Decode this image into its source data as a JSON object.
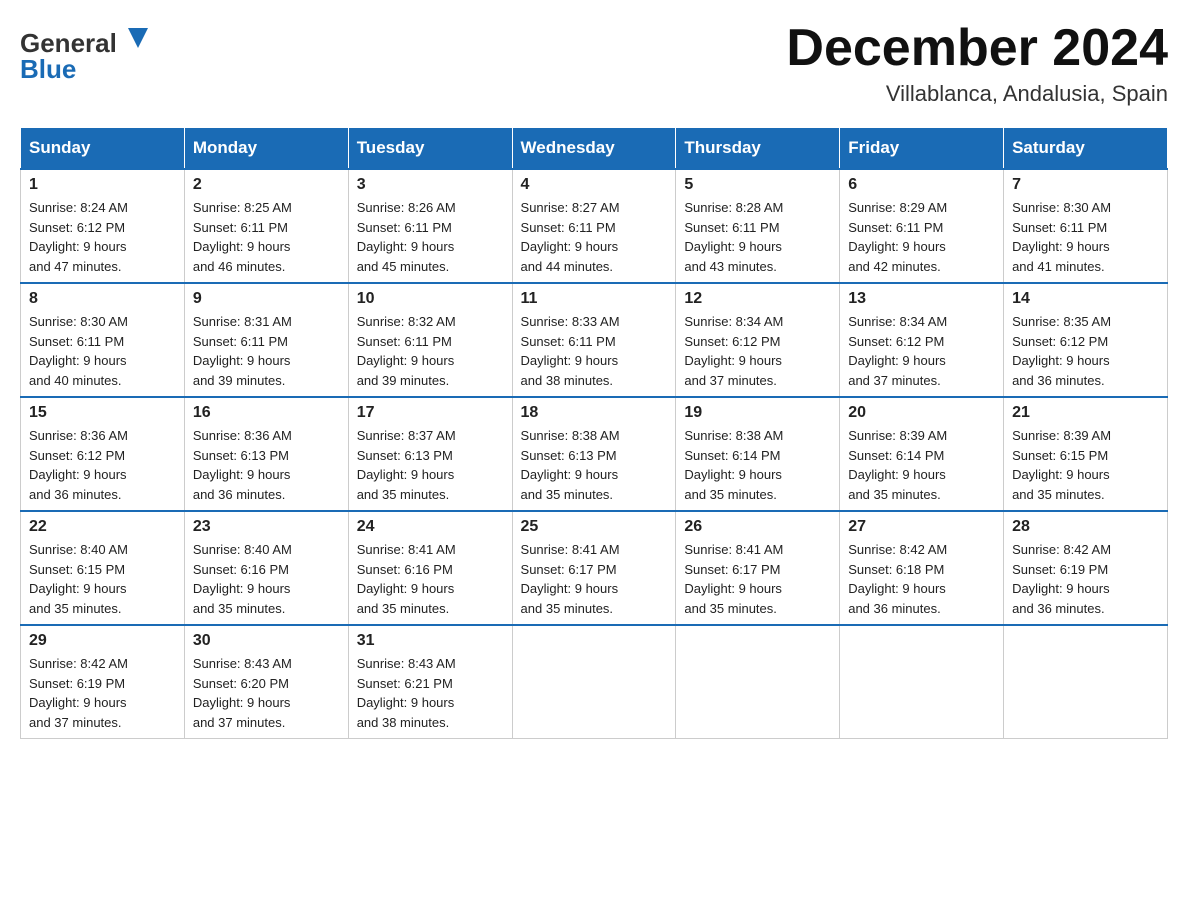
{
  "logo": {
    "general": "General",
    "blue": "Blue"
  },
  "title": "December 2024",
  "location": "Villablanca, Andalusia, Spain",
  "days_of_week": [
    "Sunday",
    "Monday",
    "Tuesday",
    "Wednesday",
    "Thursday",
    "Friday",
    "Saturday"
  ],
  "weeks": [
    [
      {
        "day": "1",
        "sunrise": "8:24 AM",
        "sunset": "6:12 PM",
        "daylight": "9 hours and 47 minutes."
      },
      {
        "day": "2",
        "sunrise": "8:25 AM",
        "sunset": "6:11 PM",
        "daylight": "9 hours and 46 minutes."
      },
      {
        "day": "3",
        "sunrise": "8:26 AM",
        "sunset": "6:11 PM",
        "daylight": "9 hours and 45 minutes."
      },
      {
        "day": "4",
        "sunrise": "8:27 AM",
        "sunset": "6:11 PM",
        "daylight": "9 hours and 44 minutes."
      },
      {
        "day": "5",
        "sunrise": "8:28 AM",
        "sunset": "6:11 PM",
        "daylight": "9 hours and 43 minutes."
      },
      {
        "day": "6",
        "sunrise": "8:29 AM",
        "sunset": "6:11 PM",
        "daylight": "9 hours and 42 minutes."
      },
      {
        "day": "7",
        "sunrise": "8:30 AM",
        "sunset": "6:11 PM",
        "daylight": "9 hours and 41 minutes."
      }
    ],
    [
      {
        "day": "8",
        "sunrise": "8:30 AM",
        "sunset": "6:11 PM",
        "daylight": "9 hours and 40 minutes."
      },
      {
        "day": "9",
        "sunrise": "8:31 AM",
        "sunset": "6:11 PM",
        "daylight": "9 hours and 39 minutes."
      },
      {
        "day": "10",
        "sunrise": "8:32 AM",
        "sunset": "6:11 PM",
        "daylight": "9 hours and 39 minutes."
      },
      {
        "day": "11",
        "sunrise": "8:33 AM",
        "sunset": "6:11 PM",
        "daylight": "9 hours and 38 minutes."
      },
      {
        "day": "12",
        "sunrise": "8:34 AM",
        "sunset": "6:12 PM",
        "daylight": "9 hours and 37 minutes."
      },
      {
        "day": "13",
        "sunrise": "8:34 AM",
        "sunset": "6:12 PM",
        "daylight": "9 hours and 37 minutes."
      },
      {
        "day": "14",
        "sunrise": "8:35 AM",
        "sunset": "6:12 PM",
        "daylight": "9 hours and 36 minutes."
      }
    ],
    [
      {
        "day": "15",
        "sunrise": "8:36 AM",
        "sunset": "6:12 PM",
        "daylight": "9 hours and 36 minutes."
      },
      {
        "day": "16",
        "sunrise": "8:36 AM",
        "sunset": "6:13 PM",
        "daylight": "9 hours and 36 minutes."
      },
      {
        "day": "17",
        "sunrise": "8:37 AM",
        "sunset": "6:13 PM",
        "daylight": "9 hours and 35 minutes."
      },
      {
        "day": "18",
        "sunrise": "8:38 AM",
        "sunset": "6:13 PM",
        "daylight": "9 hours and 35 minutes."
      },
      {
        "day": "19",
        "sunrise": "8:38 AM",
        "sunset": "6:14 PM",
        "daylight": "9 hours and 35 minutes."
      },
      {
        "day": "20",
        "sunrise": "8:39 AM",
        "sunset": "6:14 PM",
        "daylight": "9 hours and 35 minutes."
      },
      {
        "day": "21",
        "sunrise": "8:39 AM",
        "sunset": "6:15 PM",
        "daylight": "9 hours and 35 minutes."
      }
    ],
    [
      {
        "day": "22",
        "sunrise": "8:40 AM",
        "sunset": "6:15 PM",
        "daylight": "9 hours and 35 minutes."
      },
      {
        "day": "23",
        "sunrise": "8:40 AM",
        "sunset": "6:16 PM",
        "daylight": "9 hours and 35 minutes."
      },
      {
        "day": "24",
        "sunrise": "8:41 AM",
        "sunset": "6:16 PM",
        "daylight": "9 hours and 35 minutes."
      },
      {
        "day": "25",
        "sunrise": "8:41 AM",
        "sunset": "6:17 PM",
        "daylight": "9 hours and 35 minutes."
      },
      {
        "day": "26",
        "sunrise": "8:41 AM",
        "sunset": "6:17 PM",
        "daylight": "9 hours and 35 minutes."
      },
      {
        "day": "27",
        "sunrise": "8:42 AM",
        "sunset": "6:18 PM",
        "daylight": "9 hours and 36 minutes."
      },
      {
        "day": "28",
        "sunrise": "8:42 AM",
        "sunset": "6:19 PM",
        "daylight": "9 hours and 36 minutes."
      }
    ],
    [
      {
        "day": "29",
        "sunrise": "8:42 AM",
        "sunset": "6:19 PM",
        "daylight": "9 hours and 37 minutes."
      },
      {
        "day": "30",
        "sunrise": "8:43 AM",
        "sunset": "6:20 PM",
        "daylight": "9 hours and 37 minutes."
      },
      {
        "day": "31",
        "sunrise": "8:43 AM",
        "sunset": "6:21 PM",
        "daylight": "9 hours and 38 minutes."
      },
      null,
      null,
      null,
      null
    ]
  ],
  "labels": {
    "sunrise": "Sunrise:",
    "sunset": "Sunset:",
    "daylight": "Daylight:"
  }
}
